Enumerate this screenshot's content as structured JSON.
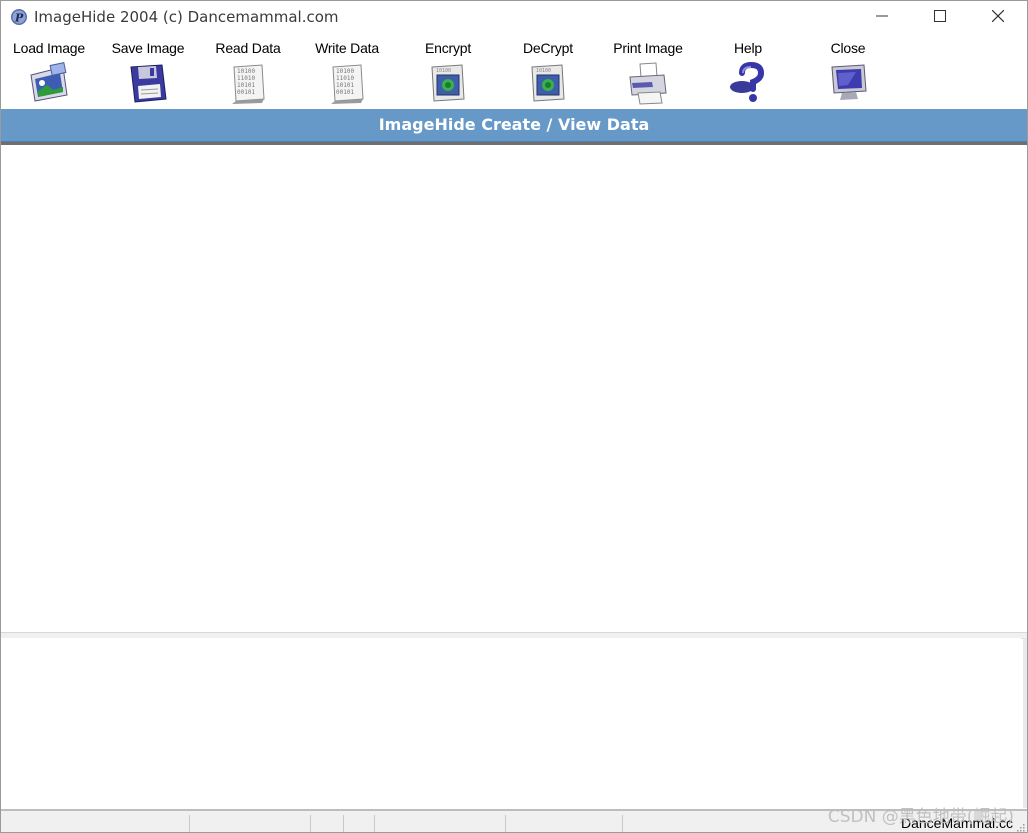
{
  "window": {
    "title": "ImageHide 2004 (c) Dancemammal.com",
    "controls": {
      "minimize": "—",
      "maximize": "☐",
      "close": "✕"
    }
  },
  "toolbar": {
    "items": [
      {
        "label": "Load Image",
        "icon": "load-image-icon"
      },
      {
        "label": "Save Image",
        "icon": "floppy-disk-icon"
      },
      {
        "label": "Read Data",
        "icon": "binary-document-icon"
      },
      {
        "label": "Write Data",
        "icon": "binary-document-icon"
      },
      {
        "label": "Encrypt",
        "icon": "encrypt-icon"
      },
      {
        "label": "DeCrypt",
        "icon": "decrypt-icon"
      },
      {
        "label": "Print Image",
        "icon": "printer-icon"
      },
      {
        "label": "Help",
        "icon": "question-mark-icon"
      },
      {
        "label": "Close",
        "icon": "monitor-icon"
      }
    ]
  },
  "header": {
    "title": "ImageHide Create / View Data"
  },
  "data_text": {
    "value": ""
  },
  "status": {
    "right_text": "DanceMammal.cc"
  },
  "watermark": {
    "text": "CSDN @黑色地带(崛起)"
  },
  "colors": {
    "band": "#6799c8",
    "window_bg": "#ffffff",
    "status_bg": "#f0f0f0"
  }
}
